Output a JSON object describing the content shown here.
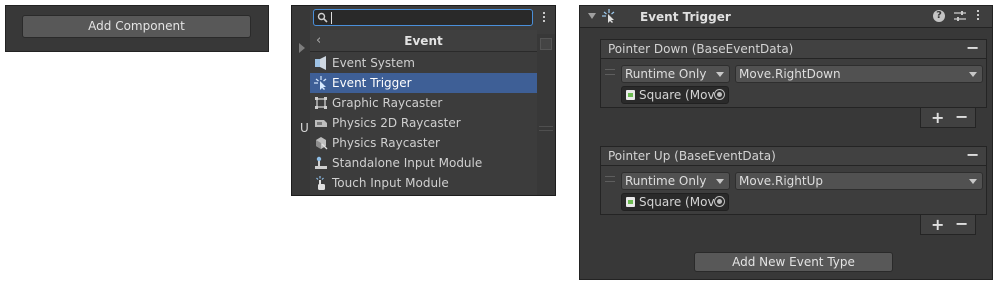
{
  "add_component_panel": {
    "button_label": "Add Component"
  },
  "picker_panel": {
    "search": {
      "value": ""
    },
    "header_title": "Event",
    "side_letter": "U",
    "items": [
      {
        "label": "Event System",
        "icon": "event-system-icon",
        "selected": false
      },
      {
        "label": "Event Trigger",
        "icon": "event-trigger-icon",
        "selected": true
      },
      {
        "label": "Graphic Raycaster",
        "icon": "graphic-raycaster-icon",
        "selected": false
      },
      {
        "label": "Physics 2D Raycaster",
        "icon": "physics-2d-raycaster-icon",
        "selected": false
      },
      {
        "label": "Physics Raycaster",
        "icon": "physics-raycaster-icon",
        "selected": false
      },
      {
        "label": "Standalone Input Module",
        "icon": "standalone-input-module-icon",
        "selected": false
      },
      {
        "label": "Touch Input Module",
        "icon": "touch-input-module-icon",
        "selected": false
      }
    ],
    "selected_color": "#3e5f96"
  },
  "event_trigger_panel": {
    "title": "Event Trigger",
    "events": [
      {
        "header": "Pointer Down (BaseEventData)",
        "runtime": "Runtime Only",
        "function": "Move.RightDown",
        "object": "Square (Mov"
      },
      {
        "header": "Pointer Up (BaseEventData)",
        "runtime": "Runtime Only",
        "function": "Move.RightUp",
        "object": "Square (Mov"
      }
    ],
    "add_button_label": "Add New Event Type"
  }
}
